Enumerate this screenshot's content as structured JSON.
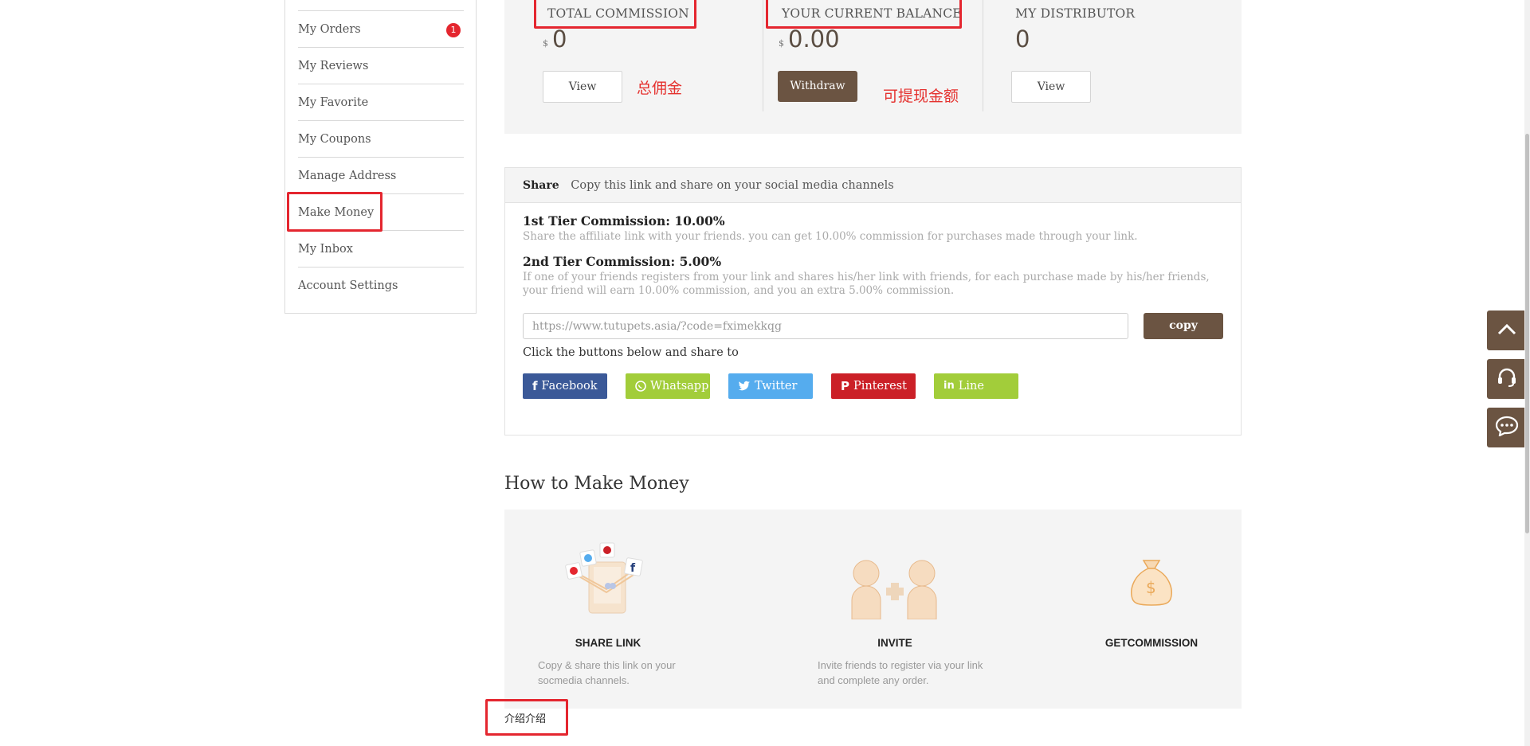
{
  "sidebar": {
    "items": [
      {
        "label": "My Orders",
        "badge": "1"
      },
      {
        "label": "My Reviews"
      },
      {
        "label": "My Favorite"
      },
      {
        "label": "My Coupons"
      },
      {
        "label": "Manage Address"
      },
      {
        "label": "Make Money"
      },
      {
        "label": "My Inbox"
      },
      {
        "label": "Account Settings"
      }
    ]
  },
  "stats": {
    "total_commission": {
      "label": "TOTAL COMMISSION",
      "currency": "$",
      "value": "0",
      "button": "View",
      "annotation": "总佣金"
    },
    "current_balance": {
      "label": "YOUR CURRENT BALANCE",
      "currency": "$",
      "value": "0.00",
      "button": "Withdraw",
      "annotation": "可提现金额"
    },
    "distributor": {
      "label": "MY DISTRIBUTOR",
      "value": "0",
      "button": "View"
    }
  },
  "share": {
    "title": "Share",
    "subtitle": "Copy this link and share on your social media channels",
    "tier1": {
      "title": "1st Tier Commission: 10.00%",
      "desc": "Share the affiliate link with your friends. you can get 10.00% commission for purchases made through your link."
    },
    "tier2": {
      "title": "2nd Tier Commission: 5.00%",
      "desc": "If one of your friends registers from your link and shares his/her link with friends, for each purchase made by his/her friends, your friend will earn 10.00% commission, and you an extra 5.00% commission."
    },
    "link_placeholder": "https://www.tutupets.asia/?code=fximekkqg",
    "copy_label": "copy",
    "share_to": "Click the buttons below and share to",
    "buttons": [
      {
        "label": "Facebook",
        "icon": "facebook-icon",
        "color": "#3b5998"
      },
      {
        "label": "Whatsapp",
        "icon": "whatsapp-icon",
        "color": "#a2cd3a"
      },
      {
        "label": "Twitter",
        "icon": "twitter-icon",
        "color": "#55acee"
      },
      {
        "label": "Pinterest",
        "icon": "pinterest-icon",
        "color": "#cb2027"
      },
      {
        "label": "Line",
        "icon": "linkedin-icon",
        "color": "#a2cd3a"
      }
    ]
  },
  "how": {
    "title": "How to Make Money",
    "steps": [
      {
        "title": "SHARE LINK",
        "desc": "Copy & share this link  on your socmedia channels."
      },
      {
        "title": "INVITE",
        "desc": "Invite friends to register via your link and complete any order."
      },
      {
        "title": "GETCOMMISSION",
        "desc": ""
      }
    ]
  },
  "bottom_note": "介绍介绍",
  "colors": {
    "brand": "#6b5442",
    "annotation": "#e4262f",
    "panel": "#f4f4f4"
  }
}
